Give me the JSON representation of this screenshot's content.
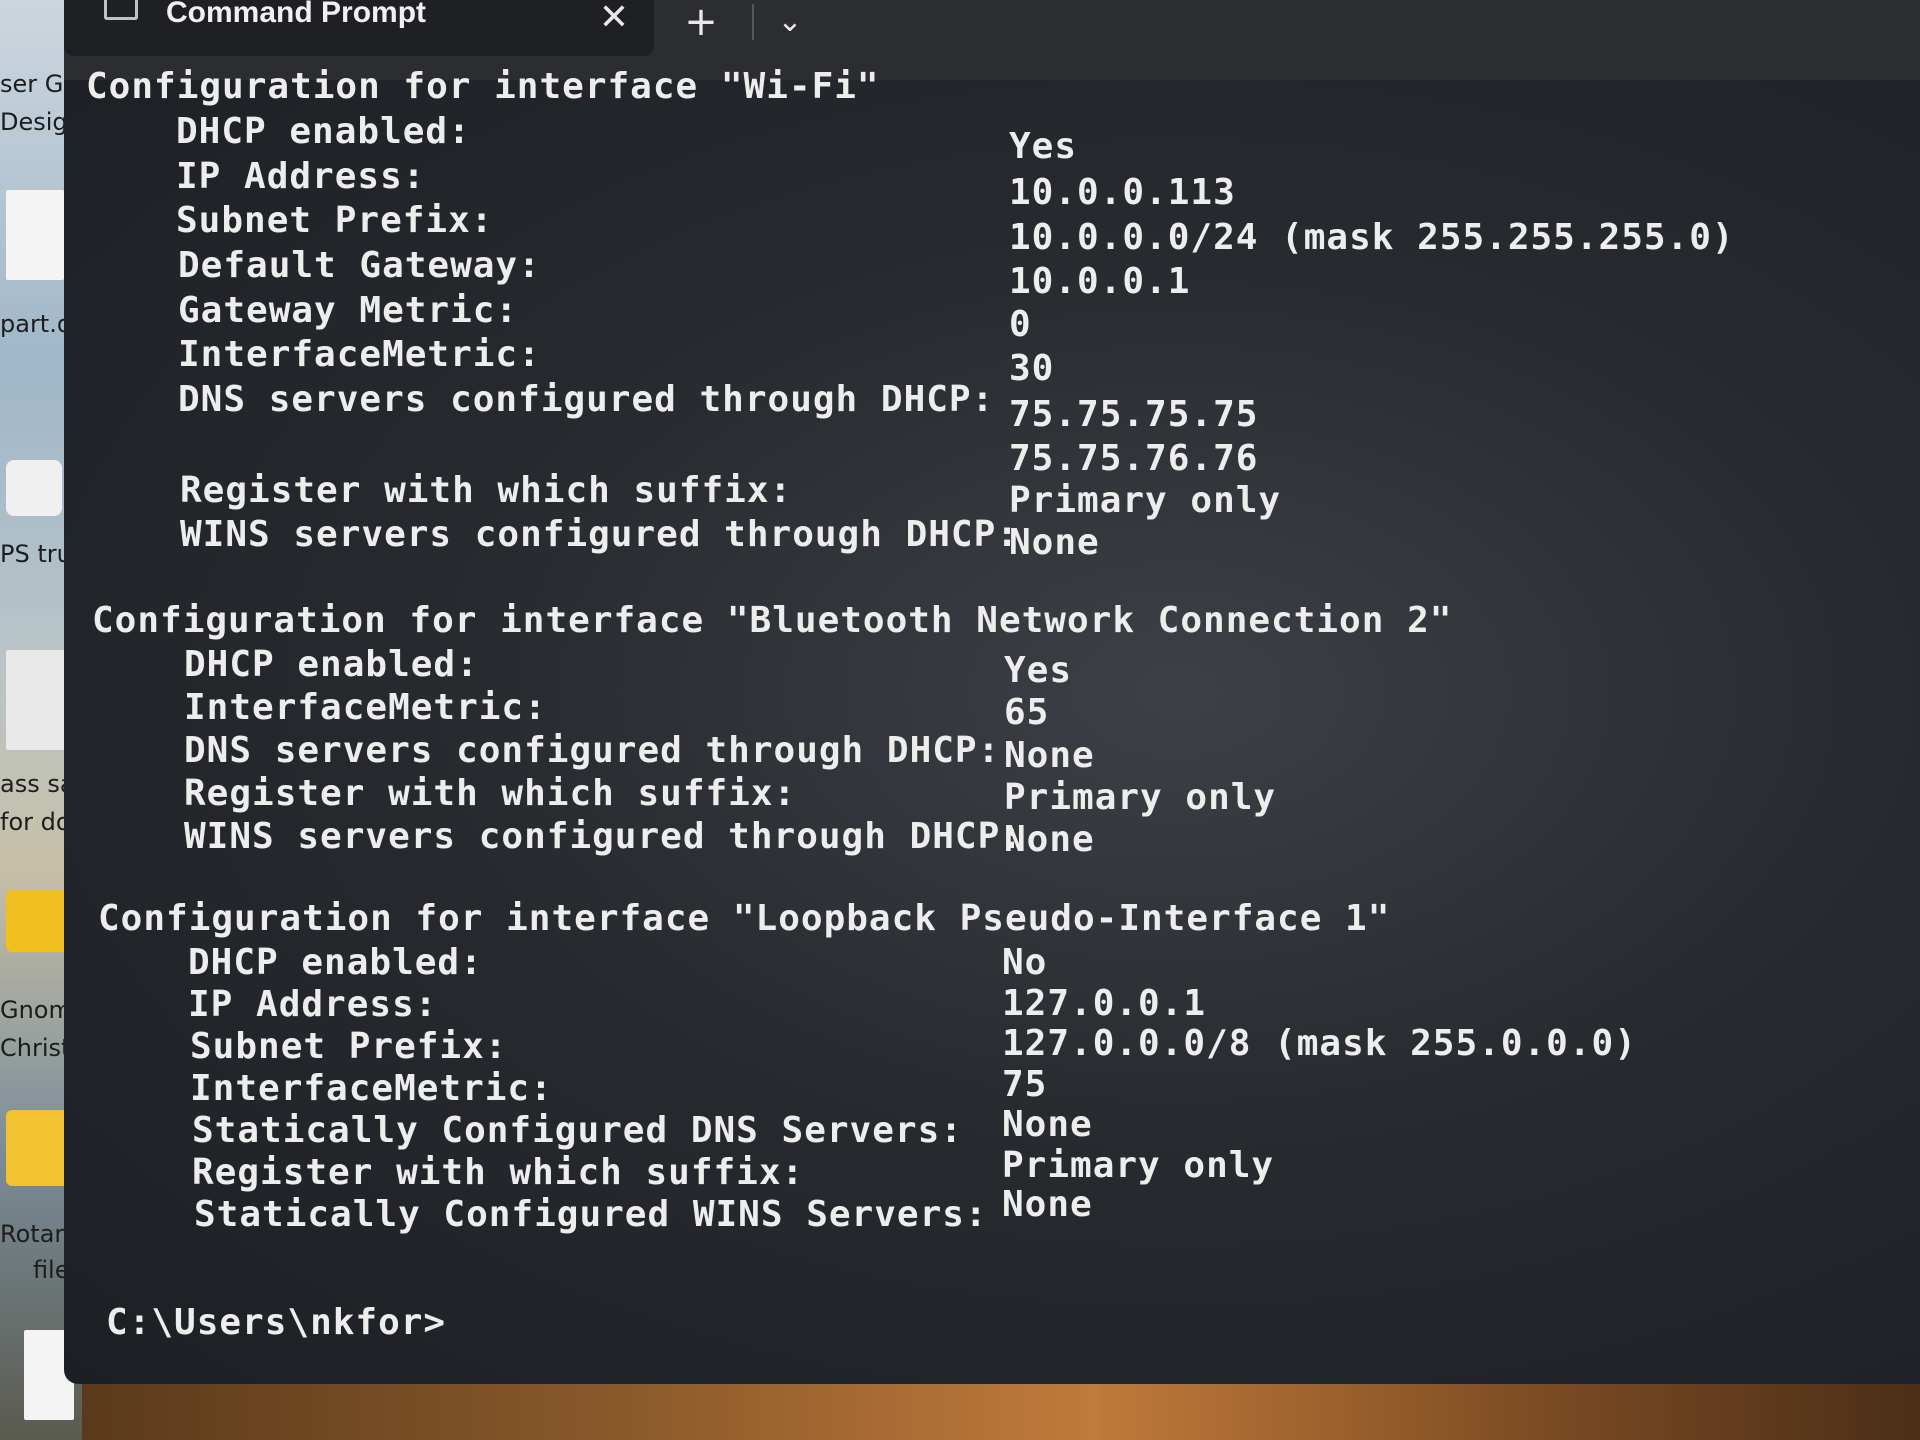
{
  "window": {
    "tab_title": "Command Prompt",
    "close_glyph": "✕",
    "new_tab_glyph": "+",
    "dropdown_glyph": "⌄"
  },
  "desktop": {
    "labels": [
      "ser G",
      "Desig",
      "part.d",
      "PS truc",
      "ass say",
      "for do",
      "Gnom",
      "Christm",
      "Rotary t",
      "files"
    ]
  },
  "sections": [
    {
      "header": "Configuration for interface \"Wi-Fi\"",
      "rows": [
        {
          "key": "DHCP enabled:",
          "value": "Yes"
        },
        {
          "key": "IP Address:",
          "value": "10.0.0.113"
        },
        {
          "key": "Subnet Prefix:",
          "value": "10.0.0.0/24 (mask 255.255.255.0)"
        },
        {
          "key": "Default Gateway:",
          "value": "10.0.0.1"
        },
        {
          "key": "Gateway Metric:",
          "value": "0"
        },
        {
          "key": "InterfaceMetric:",
          "value": "30"
        },
        {
          "key": "DNS servers configured through DHCP:",
          "value": "75.75.75.75"
        },
        {
          "key": "",
          "value": "75.75.76.76"
        },
        {
          "key": "Register with which suffix:",
          "value": "Primary only"
        },
        {
          "key": "WINS servers configured through DHCP:",
          "value": "None"
        }
      ]
    },
    {
      "header": "Configuration for interface \"Bluetooth Network Connection 2\"",
      "rows": [
        {
          "key": "DHCP enabled:",
          "value": "Yes"
        },
        {
          "key": "InterfaceMetric:",
          "value": "65"
        },
        {
          "key": "DNS servers configured through DHCP:",
          "value": "None"
        },
        {
          "key": "Register with which suffix:",
          "value": "Primary only"
        },
        {
          "key": "WINS servers configured through DHCP:",
          "value": "None"
        }
      ]
    },
    {
      "header": "Configuration for interface \"Loopback Pseudo-Interface 1\"",
      "rows": [
        {
          "key": "DHCP enabled:",
          "value": "No"
        },
        {
          "key": "IP Address:",
          "value": "127.0.0.1"
        },
        {
          "key": "Subnet Prefix:",
          "value": "127.0.0.0/8 (mask 255.0.0.0)"
        },
        {
          "key": "InterfaceMetric:",
          "value": "75"
        },
        {
          "key": "Statically Configured DNS Servers:",
          "value": "None"
        },
        {
          "key": "Register with which suffix:",
          "value": "Primary only"
        },
        {
          "key": "Statically Configured WINS Servers:",
          "value": "None"
        }
      ]
    }
  ],
  "prompt": "C:\\Users\\nkfor>"
}
